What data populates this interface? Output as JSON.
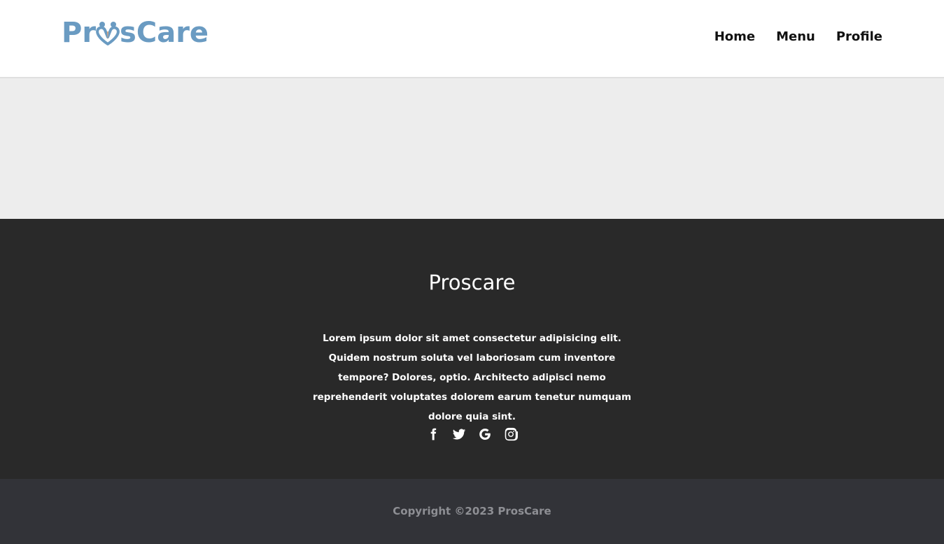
{
  "header": {
    "logo": {
      "text_before": "Pr",
      "text_after": "sCare",
      "alt": "ProsCare"
    },
    "nav": [
      {
        "label": "Home"
      },
      {
        "label": "Menu"
      },
      {
        "label": "Profile"
      }
    ]
  },
  "footer": {
    "title": "Proscare",
    "description": "Lorem ipsum dolor sit amet consectetur adipisicing elit. Quidem nostrum soluta vel laboriosam cum inventore tempore? Dolores, optio. Architecto adipisci nemo reprehenderit voluptates dolorem earum tenetur numquam dolore quia sint.",
    "socials": [
      {
        "icon": "facebook-icon"
      },
      {
        "icon": "twitter-icon"
      },
      {
        "icon": "google-icon"
      },
      {
        "icon": "instagram-icon"
      }
    ],
    "copyright": "Copyright ©2023  ProsCare"
  },
  "colors": {
    "logo": "#6a9bc2",
    "logo_accent": "#e2a77c",
    "footer_bg": "#292929",
    "bottom_bg": "#323338",
    "hero_bg": "#ededed"
  }
}
